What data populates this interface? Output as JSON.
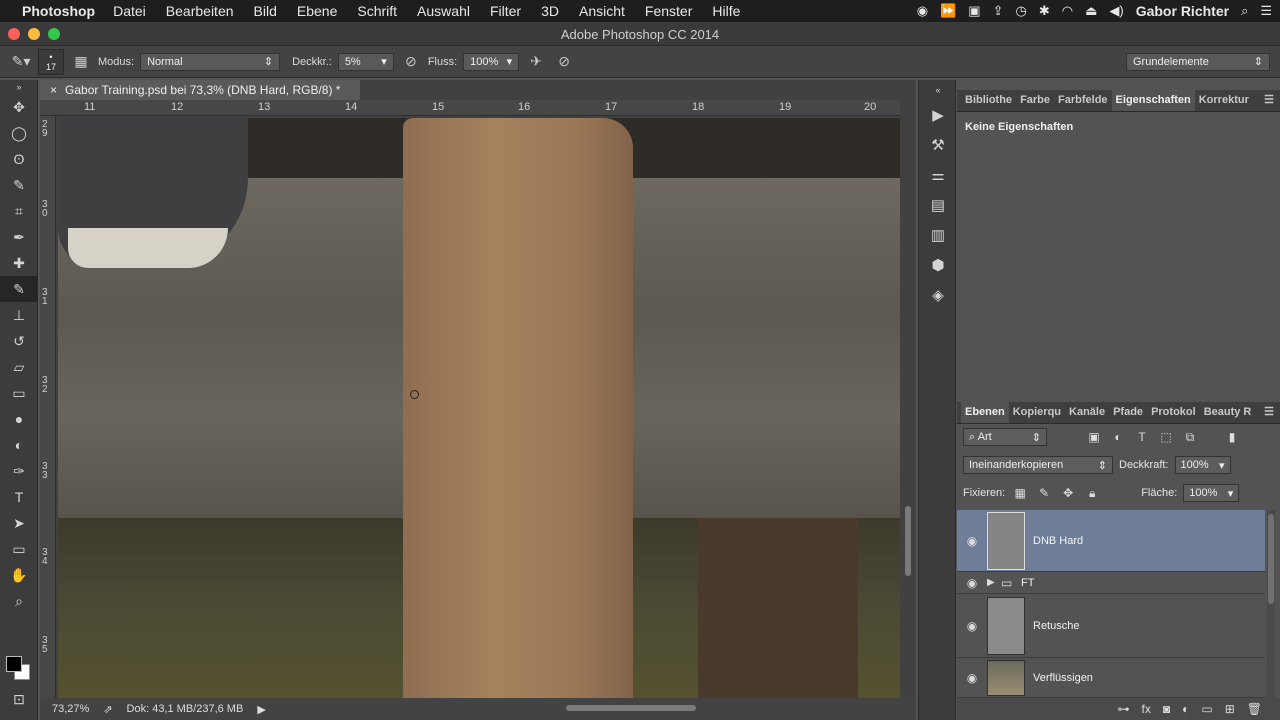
{
  "menubar": {
    "app_name": "Photoshop",
    "items": [
      "Datei",
      "Bearbeiten",
      "Bild",
      "Ebene",
      "Schrift",
      "Auswahl",
      "Filter",
      "3D",
      "Ansicht",
      "Fenster",
      "Hilfe"
    ],
    "user": "Gabor Richter"
  },
  "window": {
    "title": "Adobe Photoshop CC 2014"
  },
  "options": {
    "brush_size": "17",
    "mode_label": "Modus:",
    "mode_value": "Normal",
    "opacity_label": "Deckkr.:",
    "opacity_value": "5%",
    "flow_label": "Fluss:",
    "flow_value": "100%",
    "workspace": "Grundelemente"
  },
  "document": {
    "tab_title": "Gabor Training.psd bei 73,3% (DNB Hard, RGB/8) *",
    "ruler_top": [
      "11",
      "12",
      "13",
      "14",
      "15",
      "16",
      "17",
      "18",
      "19",
      "20"
    ],
    "ruler_left": [
      "2 9",
      "3 0",
      "3 1",
      "3 2",
      "3 3",
      "3 4",
      "3 5"
    ],
    "zoom": "73,27%",
    "doc_size": "Dok: 43,1 MB/237,6 MB"
  },
  "properties_panel": {
    "tabs": [
      "Bibliothe",
      "Farbe",
      "Farbfelde",
      "Eigenschaften",
      "Korrektur"
    ],
    "active_tab": "Eigenschaften",
    "empty_text": "Keine Eigenschaften"
  },
  "layers_panel": {
    "tabs": [
      "Ebenen",
      "Kopierqu",
      "Kanäle",
      "Pfade",
      "Protokol",
      "Beauty R"
    ],
    "filter_kind": "Art",
    "blend_mode": "Ineinanderkopieren",
    "opacity_label": "Deckkraft:",
    "opacity_value": "100%",
    "lock_label": "Fixieren:",
    "fill_label": "Fläche:",
    "fill_value": "100%",
    "layers": [
      {
        "name": "DNB Hard",
        "selected": true
      },
      {
        "name": "FT",
        "group": true
      },
      {
        "name": "Retusche"
      },
      {
        "name": "Verflüssigen"
      }
    ]
  }
}
